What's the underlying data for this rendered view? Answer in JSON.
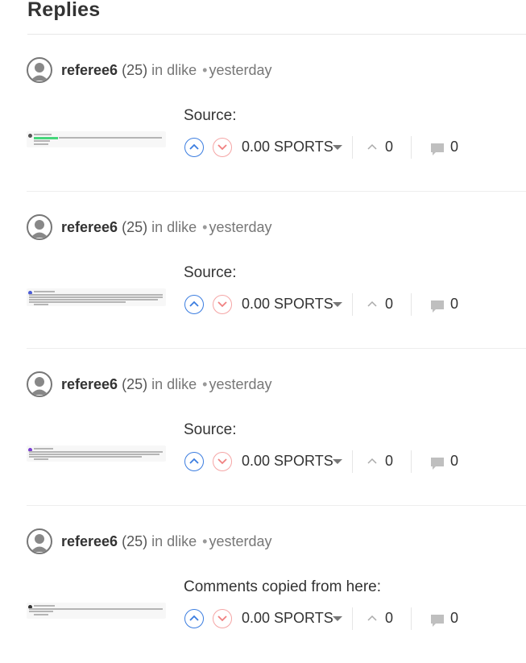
{
  "page": {
    "title": "Replies"
  },
  "replies": [
    {
      "author": "referee6",
      "reputation": "(25)",
      "community": "in dlike",
      "separator": "•",
      "time": "yesterday",
      "body": "Source:",
      "payout": "0.00 SPORTS",
      "votes": "0",
      "comments": "0"
    },
    {
      "author": "referee6",
      "reputation": "(25)",
      "community": "in dlike",
      "separator": "•",
      "time": "yesterday",
      "body": "Source:",
      "payout": "0.00 SPORTS",
      "votes": "0",
      "comments": "0"
    },
    {
      "author": "referee6",
      "reputation": "(25)",
      "community": "in dlike",
      "separator": "•",
      "time": "yesterday",
      "body": "Source:",
      "payout": "0.00 SPORTS",
      "votes": "0",
      "comments": "0"
    },
    {
      "author": "referee6",
      "reputation": "(25)",
      "community": "in dlike",
      "separator": "•",
      "time": "yesterday",
      "body": "Comments copied from here:",
      "payout": "0.00 SPORTS",
      "votes": "0",
      "comments": "0"
    }
  ],
  "colors": {
    "upvote": "#3b7de0",
    "downvote": "#f5a5a5",
    "text": "#333333",
    "muted": "#777777"
  },
  "icons": [
    "avatar-icon",
    "upvote-icon",
    "downvote-icon",
    "dropdown-caret-icon",
    "vote-count-icon",
    "comment-icon"
  ]
}
